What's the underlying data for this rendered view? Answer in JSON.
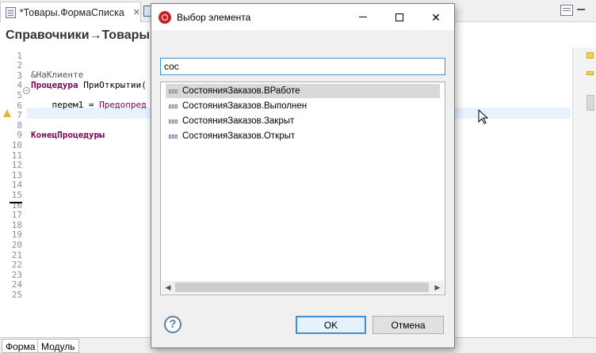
{
  "editor": {
    "tab_title": "*Товары.ФормаСписка",
    "tab_close": "✕",
    "breadcrumb": "Справочники→Товары→",
    "code_lines": [
      {
        "num": "1",
        "text": ""
      },
      {
        "num": "2",
        "text": ""
      },
      {
        "num": "3",
        "text": "&НаКлиенте"
      },
      {
        "num": "4",
        "keyword": "Процедура",
        "text": " ПриОткрытии("
      },
      {
        "num": "5",
        "text": ""
      },
      {
        "num": "6",
        "text": "    перем1 = ",
        "ref": "Предопред"
      },
      {
        "num": "7",
        "text": ""
      },
      {
        "num": "8",
        "text": ""
      },
      {
        "num": "9",
        "keyword": "КонецПроцедуры",
        "text": ""
      },
      {
        "num": "10",
        "text": ""
      },
      {
        "num": "11",
        "text": ""
      },
      {
        "num": "12",
        "text": ""
      },
      {
        "num": "13",
        "text": ""
      },
      {
        "num": "14",
        "text": ""
      },
      {
        "num": "15",
        "text": ""
      },
      {
        "num": "16",
        "text": ""
      },
      {
        "num": "17",
        "text": ""
      },
      {
        "num": "18",
        "text": ""
      },
      {
        "num": "19",
        "text": ""
      },
      {
        "num": "20",
        "text": ""
      },
      {
        "num": "21",
        "text": ""
      },
      {
        "num": "22",
        "text": ""
      },
      {
        "num": "23",
        "text": ""
      },
      {
        "num": "24",
        "text": ""
      },
      {
        "num": "25",
        "text": ""
      }
    ],
    "bottom_tabs": [
      "Форма",
      "Модуль"
    ],
    "colors": {
      "keyword": "#7f0055",
      "ref": "#7f0055",
      "current_line": "#e8f2fe"
    }
  },
  "dialog": {
    "title": "Выбор элемента",
    "search_value": "сос",
    "items": [
      "СостоянияЗаказов.ВРаботе",
      "СостоянияЗаказов.Выполнен",
      "СостоянияЗаказов.Закрыт",
      "СостоянияЗаказов.Открыт"
    ],
    "selected_index": 0,
    "ok_label": "OK",
    "cancel_label": "Отмена",
    "help_glyph": "?",
    "scroll_left": "◀",
    "scroll_right": "▶",
    "close_glyph": "✕"
  }
}
